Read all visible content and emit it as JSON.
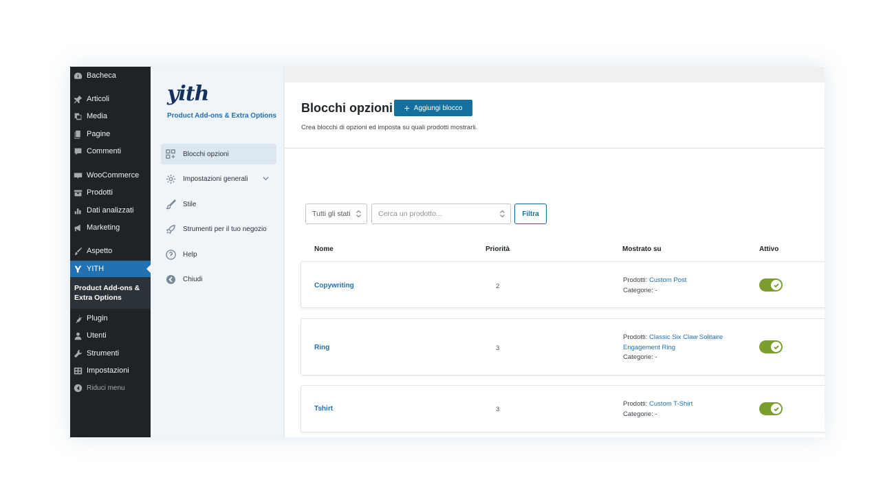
{
  "wp_menu": {
    "items": [
      {
        "label": "Bacheca",
        "icon": "dashboard-icon"
      },
      {
        "label": "Articoli",
        "icon": "pin-icon"
      },
      {
        "label": "Media",
        "icon": "media-icon"
      },
      {
        "label": "Pagine",
        "icon": "pages-icon"
      },
      {
        "label": "Commenti",
        "icon": "comments-icon"
      },
      {
        "label": "WooCommerce",
        "icon": "woocommerce-icon"
      },
      {
        "label": "Prodotti",
        "icon": "products-icon"
      },
      {
        "label": "Dati analizzati",
        "icon": "analytics-icon"
      },
      {
        "label": "Marketing",
        "icon": "megaphone-icon"
      },
      {
        "label": "Aspetto",
        "icon": "brush-icon"
      },
      {
        "label": "YITH",
        "icon": "yith-icon"
      },
      {
        "label": "Plugin",
        "icon": "plugin-icon"
      },
      {
        "label": "Utenti",
        "icon": "users-icon"
      },
      {
        "label": "Strumenti",
        "icon": "wrench-icon"
      },
      {
        "label": "Impostazioni",
        "icon": "settings-icon"
      },
      {
        "label": "Riduci menu",
        "icon": "collapse-icon"
      }
    ],
    "submenu_label": "Product Add-ons & Extra Options"
  },
  "plugin": {
    "logo_text": "yith",
    "title": "Product Add-ons & Extra Options",
    "nav": [
      {
        "label": "Blocchi opzioni",
        "icon": "blocks-icon"
      },
      {
        "label": "Impostazioni generali",
        "icon": "gear-icon"
      },
      {
        "label": "Stile",
        "icon": "brush-icon"
      },
      {
        "label": "Strumenti per il tuo negozio",
        "icon": "rocket-icon"
      },
      {
        "label": "Help",
        "icon": "help-icon"
      },
      {
        "label": "Chiudi",
        "icon": "back-icon"
      }
    ]
  },
  "main": {
    "title": "Blocchi opzioni",
    "add_button": "Aggiungi blocco",
    "subtitle": "Crea blocchi di opzioni ed imposta su quali prodotti mostrarli.",
    "filters": {
      "status_value": "Tutti gli stati",
      "product_placeholder": "Cerca un prodotto...",
      "filter_button": "Filtra"
    },
    "columns": [
      "Nome",
      "Priorità",
      "Mostrato su",
      "Attivo"
    ],
    "rows": [
      {
        "name": "Copywriting",
        "priority": "2",
        "products_label": "Prodotti:",
        "products": "Custom Post",
        "categories_label": "Categorie:",
        "categories": "-",
        "active": true
      },
      {
        "name": "Ring",
        "priority": "3",
        "products_label": "Prodotti:",
        "products": "Classic Six Claw Solitaire Engagement Ring",
        "categories_label": "Categorie:",
        "categories": "-",
        "active": true
      },
      {
        "name": "Tshirt",
        "priority": "3",
        "products_label": "Prodotti:",
        "products": "Custom T-Shirt",
        "categories_label": "Categorie:",
        "categories": "-",
        "active": true
      }
    ]
  },
  "colors": {
    "wp_sidebar": "#1d2327",
    "wp_active": "#2271b1",
    "primary_button": "#14719e",
    "link": "#1f6fb2",
    "toggle_on": "#7b9e2f"
  }
}
